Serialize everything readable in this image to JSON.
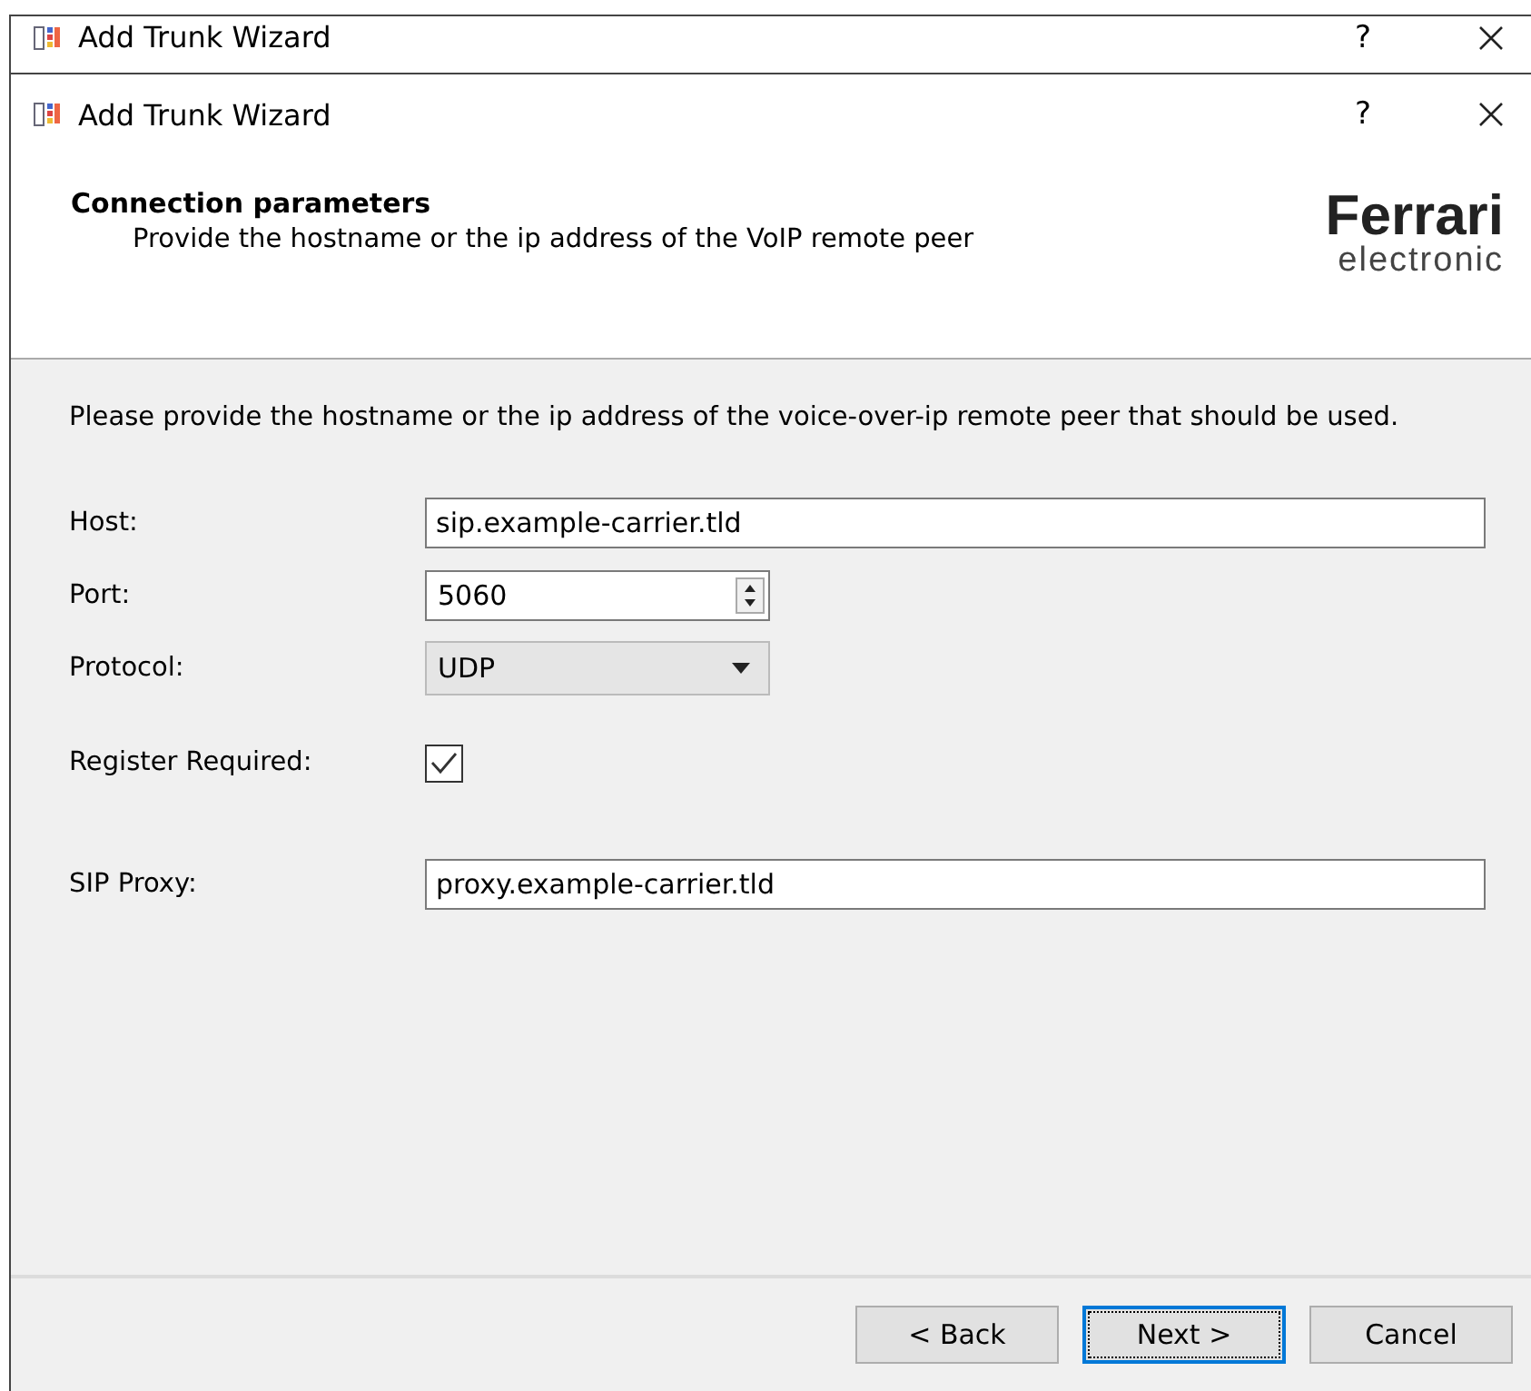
{
  "background_window": {
    "title": "Add Trunk Wizard",
    "help": "?"
  },
  "window": {
    "title": "Add Trunk Wizard",
    "help": "?"
  },
  "header": {
    "title": "Connection parameters",
    "subtitle": "Provide the hostname or the ip address of the VoIP remote peer",
    "logo_name": "Ferrari",
    "logo_sub": "electronic"
  },
  "instruction": "Please provide the hostname or the ip address of the voice-over-ip remote peer that should be used.",
  "fields": [
    {
      "kind": "text",
      "label": "Host:",
      "value": "sip.example-carrier.tld"
    },
    {
      "kind": "spin",
      "label": "Port:",
      "value": "5060"
    },
    {
      "kind": "select",
      "label": "Protocol:",
      "value": "UDP"
    },
    {
      "kind": "checkbox",
      "label": "Register Required:",
      "checked": true
    },
    {
      "kind": "text",
      "label": "SIP Proxy:",
      "value": "proxy.example-carrier.tld"
    }
  ],
  "buttons": [
    {
      "label": "< Back",
      "default": false
    },
    {
      "label": "Next >",
      "default": true
    },
    {
      "label": "Cancel",
      "default": false
    }
  ]
}
